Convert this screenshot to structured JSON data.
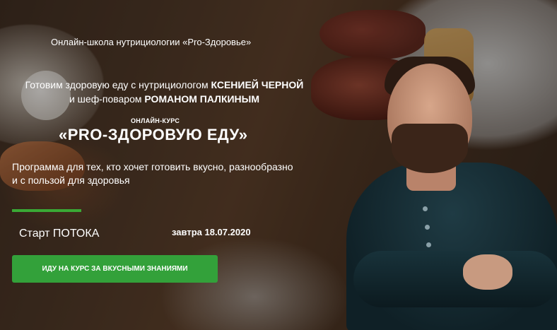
{
  "hero": {
    "school_line": "Онлайн-школа нутрициологии «Pro-Здоровье»",
    "intro_prefix": "Готовим здоровую еду с нутрициологом ",
    "nutritionist_name": "КСЕНИЕЙ ЧЕРНОЙ",
    "intro_middle": "и шеф-поваром ",
    "chef_name": "РОМАНОМ ПАЛКИНЫМ",
    "course_label": "ОНЛАЙН-КУРС",
    "course_title": "«PRO-ЗДОРОВУЮ ЕДУ»",
    "description_line1": "Программа для тех, кто хочет готовить вкусно, разнообразно",
    "description_line2": "и с пользой для здоровья",
    "start_label": "Старт ПОТОКА",
    "start_date": "завтра 18.07.2020",
    "cta_label": "ИДУ НА КУРС ЗА ВКУСНЫМИ ЗНАНИЯМИ"
  },
  "colors": {
    "accent_green": "#33a13a",
    "text": "#ffffff"
  },
  "images": {
    "background": "food-plates-photo",
    "chef": "chef-portrait-photo"
  }
}
